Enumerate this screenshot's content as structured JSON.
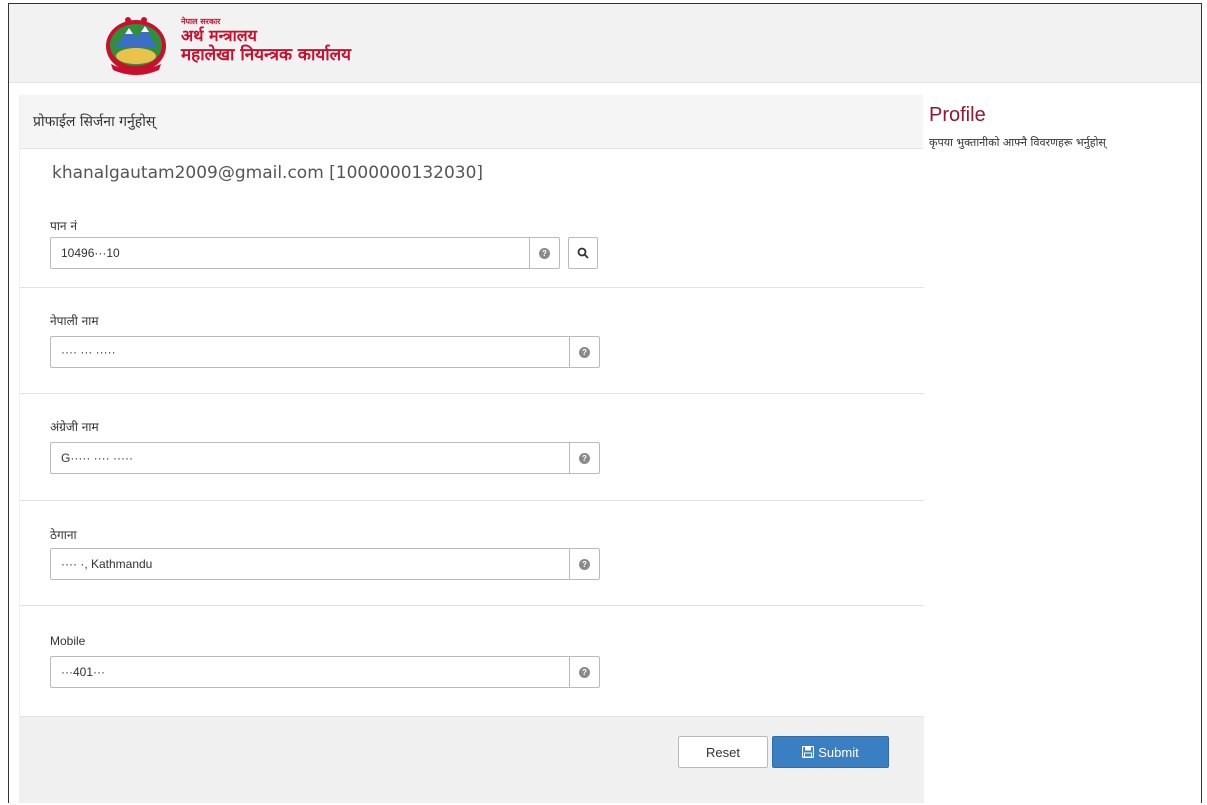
{
  "header": {
    "org_small": "नेपाल सरकार",
    "org_line1": "अर्थ मन्त्रालय",
    "org_line2": "महालेखा नियन्त्रक कार्यालय"
  },
  "panel": {
    "title": "प्रोफाईल सिर्जना गर्नुहोस्",
    "user_email": "khanalgautam2009@gmail.com [1000000132030]"
  },
  "fields": {
    "pan": {
      "label": "पान नं",
      "value": "10496···10"
    },
    "nepali_name": {
      "label": "नेपाली नाम",
      "value": "···· ··· ·····"
    },
    "english_name": {
      "label": "अंग्रेजी नाम",
      "value": "G····· ···· ·····"
    },
    "address": {
      "label": "ठेगाना",
      "value": "···· ·, Kathmandu"
    },
    "mobile": {
      "label": "Mobile",
      "value": "···401···"
    }
  },
  "buttons": {
    "reset": "Reset",
    "submit": "Submit"
  },
  "sidebar": {
    "title": "Profile",
    "description": "कृपया भुक्तानीको आफ्नै विवरणहरू भर्नुहोस्"
  },
  "icons": {
    "help": "question-circle-icon",
    "search": "search-icon",
    "save": "floppy-disk-icon",
    "emblem": "nepal-emblem-icon"
  },
  "colors": {
    "submit": "#3a7fc1",
    "org_text": "#c8102e",
    "sidebar_title": "#8b1a33"
  }
}
